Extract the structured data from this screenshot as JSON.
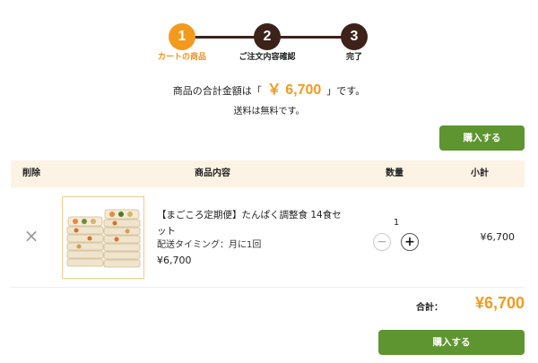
{
  "stepper": {
    "steps": [
      {
        "number": "1",
        "label": "カートの商品",
        "state": "active"
      },
      {
        "number": "2",
        "label": "ご注文内容確認",
        "state": "todo"
      },
      {
        "number": "3",
        "label": "完了",
        "state": "todo"
      }
    ]
  },
  "summary": {
    "prefix": "商品の合計金額は「",
    "amount": "￥ 6,700",
    "suffix": "」です。",
    "shipping": "送料は無料です。"
  },
  "buttons": {
    "purchase_top": "購入する",
    "purchase_bottom": "購入する"
  },
  "table": {
    "headers": {
      "delete": "削除",
      "item": "商品内容",
      "quantity": "数量",
      "subtotal": "小計"
    },
    "rows": [
      {
        "name": "【まごころ定期便】たんぱく調整食 14食セット",
        "timing": "配送タイミング：月に1回",
        "price": "¥6,700",
        "quantity": "1",
        "subtotal": "¥6,700"
      }
    ]
  },
  "total": {
    "label": "合計：",
    "value": "¥6,700"
  },
  "colors": {
    "accent_orange": "#f29a1d",
    "step_dark": "#3d2219",
    "button_green": "#5f9530",
    "header_bg": "#fdf3e4"
  }
}
